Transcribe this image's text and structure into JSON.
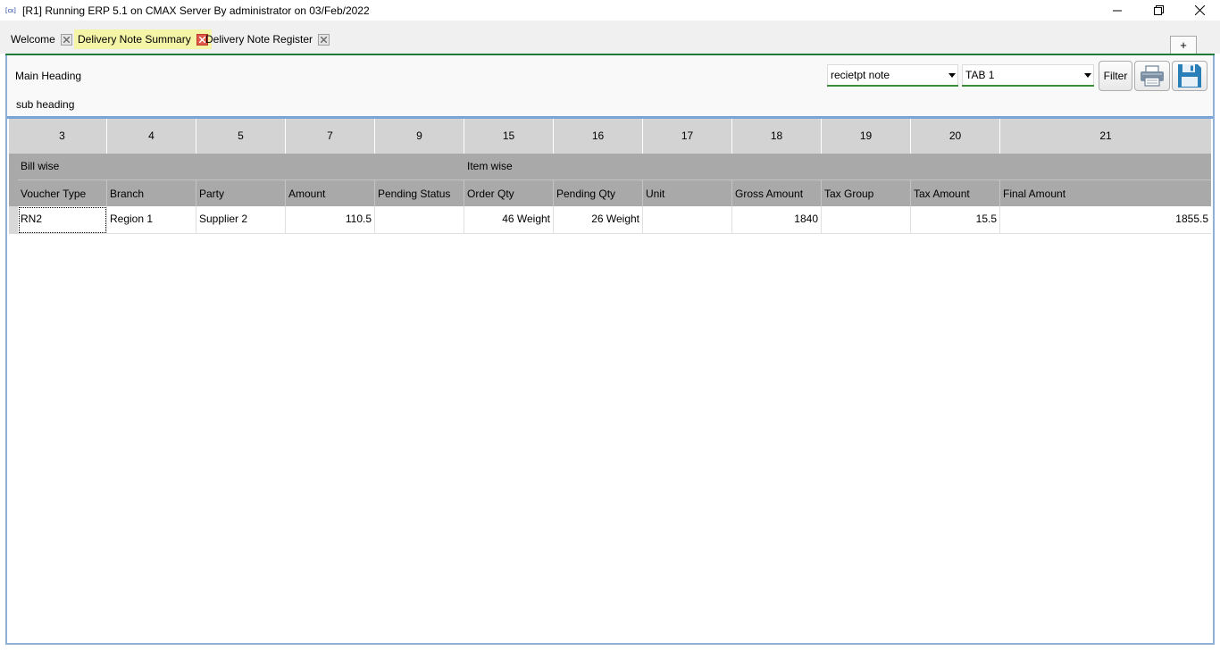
{
  "window": {
    "title": "[R1] Running ERP 5.1 on CMAX Server By administrator on 03/Feb/2022",
    "icon_text": "[cx]"
  },
  "tabs": [
    {
      "label": "Welcome",
      "active": false
    },
    {
      "label": "Delivery Note Summary",
      "active": true
    },
    {
      "label": "Delivery Note Register",
      "active": false
    }
  ],
  "add_tab_label": "+",
  "header": {
    "main_heading": "Main Heading",
    "sub_heading": "sub heading",
    "report_select": "recietpt note",
    "tab_select": "TAB 1",
    "filter_label": "Filter"
  },
  "grid": {
    "column_numbers": [
      "3",
      "4",
      "5",
      "7",
      "9",
      "15",
      "16",
      "17",
      "18",
      "19",
      "20",
      "21"
    ],
    "groups": [
      "Bill wise",
      "Item wise"
    ],
    "columns": [
      "Voucher Type",
      "Branch",
      "Party",
      "Amount",
      "Pending Status",
      "Order Qty",
      "Pending Qty",
      "Unit",
      "Gross Amount",
      "Tax Group",
      "Tax Amount",
      "Final Amount"
    ],
    "rows": [
      [
        "RN2",
        "Region 1",
        "Supplier 2",
        "110.5",
        "",
        "46 Weight",
        "26 Weight",
        "",
        "1840",
        "",
        "15.5",
        "1855.5"
      ]
    ]
  },
  "colors": {
    "active_tab": "#f5f5a8",
    "accent_green": "#1e7b3a",
    "panel_border": "#8fb0d8",
    "header_gray": "#a9a9a9",
    "number_gray": "#d3d3d3"
  }
}
